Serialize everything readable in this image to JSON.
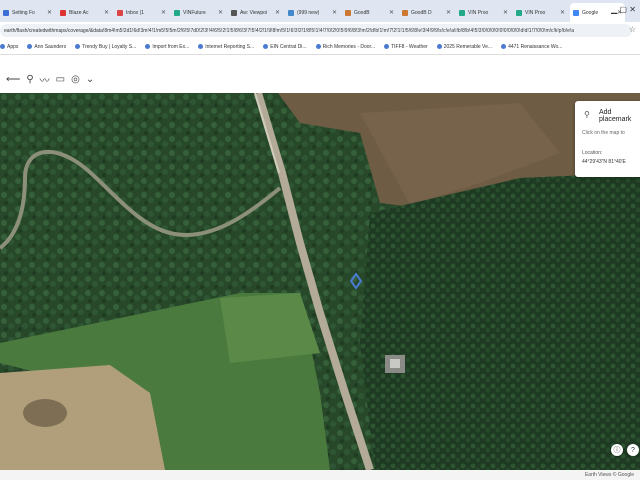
{
  "browser": {
    "tabs": [
      {
        "label": "Setting Fo",
        "color": "#3b6fd8"
      },
      {
        "label": "Blaze Ac",
        "color": "#d33"
      },
      {
        "label": "Inbox (1",
        "color": "#d44"
      },
      {
        "label": "VINFuture",
        "color": "#2a8"
      },
      {
        "label": "Aw: Viewpoi",
        "color": "#555"
      },
      {
        "label": "(999 new)",
        "color": "#48c"
      },
      {
        "label": "GoodB",
        "color": "#c73"
      },
      {
        "label": "GoodB D",
        "color": "#c73"
      },
      {
        "label": "VIN Proo",
        "color": "#2a8"
      },
      {
        "label": "VIN Proo",
        "color": "#2a8"
      },
      {
        "label": "Google",
        "color": "#4285f4"
      }
    ],
    "active_tab_index": 10,
    "url": "earth/flash/createdwithmaps/coverage/&data!8m4!m5!2d1!6d!3m!4!1!m5!5!5m!2!6!5!7d0!2!3!!4!6!5!2!1!5!8!6!3!7!5!4!2!1!9!8!m!5!1!6!3!2!1!8!5!1!4!7!0!2!0!5!9!6!8!3!m!2!d!b!1!m!7!2!1!1!5!6!8!e!3!4!9!9!s!c!e!a!i!b!8!b!4!5!3!0!0!0!0!0!0!0!0!0!d!d!1!7!0!0!m!c!k!p!b!e!a",
    "bookmarks": [
      "Apps",
      "Ann Saunders",
      "Trendy Buy | Loyalty S...",
      "Import from Ex...",
      "Internet Reporting S...",
      "EIN Centrat Di...",
      "Rich Memories - Door...",
      "TIFF8 - Weather",
      "2025 Remerable Ve...",
      "4471 Renaissance Wo..."
    ]
  },
  "toolbar": {
    "icons": [
      "arrow-icon",
      "pin-icon",
      "path-icon",
      "ruler-icon",
      "mail-icon",
      "camera-icon",
      "overflow-icon"
    ]
  },
  "infocard": {
    "title": "Add placemark",
    "hint": "Click on the map to",
    "location_label": "Location:",
    "location_value": "44°29'43\"N 81°40'E"
  },
  "footer": {
    "credit": "Earth Views © Google"
  },
  "colors": {
    "accent": "#1a73e8",
    "pin": "#4a7bd1"
  }
}
